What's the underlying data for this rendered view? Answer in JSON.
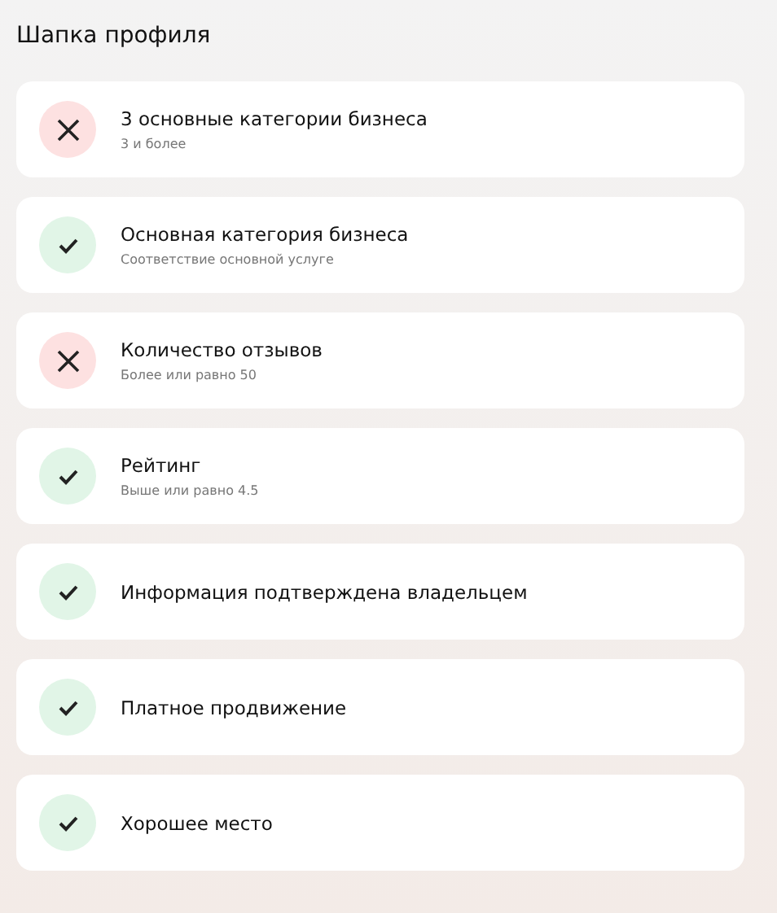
{
  "title": "Шапка профиля",
  "checks": [
    {
      "label": "3 основные категории бизнеса",
      "hint": "3 и более",
      "passed": false
    },
    {
      "label": "Основная категория бизнеса",
      "hint": "Соответствие основной услуге",
      "passed": true
    },
    {
      "label": "Количество отзывов",
      "hint": "Более или равно 50",
      "passed": false
    },
    {
      "label": "Рейтинг",
      "hint": "Выше или равно 4.5",
      "passed": true
    },
    {
      "label": "Информация подтверждена владельцем",
      "passed": true
    },
    {
      "label": "Платное продвижение",
      "passed": true
    },
    {
      "label": "Хорошее место",
      "passed": true
    }
  ]
}
